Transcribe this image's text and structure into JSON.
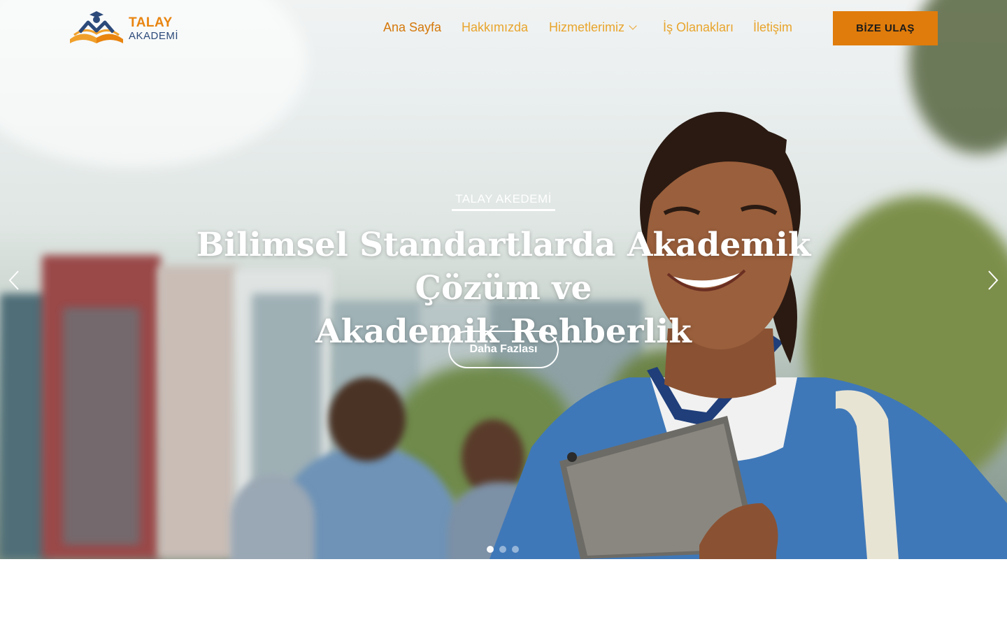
{
  "header": {
    "logo": {
      "line1": "TALAY",
      "line2": "AKADEMİ"
    },
    "nav": [
      {
        "label": "Ana Sayfa",
        "active": true
      },
      {
        "label": "Hakkımızda",
        "active": false
      },
      {
        "label": "Hizmetlerimiz",
        "active": false,
        "dropdown": true
      },
      {
        "label": "İş Olanakları",
        "active": false
      },
      {
        "label": "İletişim",
        "active": false
      }
    ],
    "cta_label": "BİZE ULAŞ"
  },
  "hero": {
    "eyebrow": "TALAY AKEDEMİ",
    "title_line1": "Bilimsel Standartlarda Akademik Çözüm ve",
    "title_line2": "Akademik Rehberlik",
    "button_label": "Daha Fazlası",
    "slides_total": 3,
    "active_slide": 1
  },
  "colors": {
    "brand_orange": "#e07c0b",
    "nav_text": "#e8a52d",
    "logo_blue": "#2c4a7a"
  },
  "icons": [
    "logo-emblem-icon",
    "chevron-down-icon",
    "arrow-left-icon",
    "arrow-right-icon"
  ]
}
